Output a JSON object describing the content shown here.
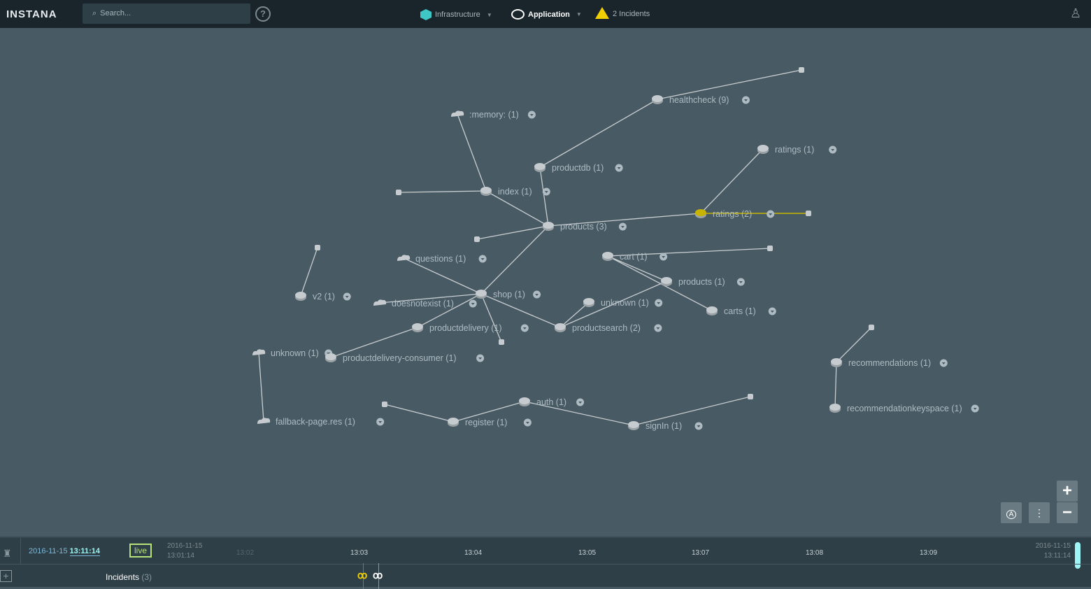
{
  "topbar": {
    "logo": "INSTANA",
    "search_placeholder": "Search...",
    "help": "?",
    "nav": [
      {
        "label": "Infrastructure",
        "icon": "hexagon-icon"
      },
      {
        "label": "Application",
        "icon": "disc-icon"
      },
      {
        "label": "2 Incidents",
        "icon": "warning-icon"
      }
    ]
  },
  "graph": {
    "nodes": [
      {
        "id": 1,
        "label": "healthcheck (9)",
        "kind": "db"
      },
      {
        "id": 2,
        "label": "",
        "kind": "small"
      },
      {
        "id": 3,
        "label": ":memory: (1)",
        "kind": "cloud"
      },
      {
        "id": 4,
        "label": "productdb (1)",
        "kind": "db"
      },
      {
        "id": 5,
        "label": "ratings (1)",
        "kind": "db"
      },
      {
        "id": 6,
        "label": "",
        "kind": "small"
      },
      {
        "id": 7,
        "label": "index (1)",
        "kind": "db"
      },
      {
        "id": 8,
        "label": "ratings (2)",
        "kind": "db",
        "highlight": true
      },
      {
        "id": 9,
        "label": "",
        "kind": "small"
      },
      {
        "id": 10,
        "label": "products (3)",
        "kind": "db"
      },
      {
        "id": 11,
        "label": "",
        "kind": "small"
      },
      {
        "id": 12,
        "label": "",
        "kind": "small"
      },
      {
        "id": 13,
        "label": "questions (1)",
        "kind": "cloud"
      },
      {
        "id": 14,
        "label": "cart (1)",
        "kind": "db"
      },
      {
        "id": 15,
        "label": "",
        "kind": "small"
      },
      {
        "id": 16,
        "label": "v2 (1)",
        "kind": "db"
      },
      {
        "id": 17,
        "label": "shop (1)",
        "kind": "db"
      },
      {
        "id": 18,
        "label": "products (1)",
        "kind": "db"
      },
      {
        "id": 19,
        "label": "doesnotexist (1)",
        "kind": "cloud"
      },
      {
        "id": 20,
        "label": "unknown (1)",
        "kind": "db"
      },
      {
        "id": 21,
        "label": "carts (1)",
        "kind": "db"
      },
      {
        "id": 22,
        "label": "productdelivery (1)",
        "kind": "db"
      },
      {
        "id": 23,
        "label": "productsearch (2)",
        "kind": "db"
      },
      {
        "id": 24,
        "label": "",
        "kind": "small"
      },
      {
        "id": 25,
        "label": "unknown (1)",
        "kind": "cloud"
      },
      {
        "id": 26,
        "label": "productdelivery-consumer (1)",
        "kind": "db"
      },
      {
        "id": 27,
        "label": "",
        "kind": "small"
      },
      {
        "id": 28,
        "label": "recommendations (1)",
        "kind": "db"
      },
      {
        "id": 29,
        "label": "auth (1)",
        "kind": "db"
      },
      {
        "id": 30,
        "label": "",
        "kind": "small"
      },
      {
        "id": 31,
        "label": "register (1)",
        "kind": "db"
      },
      {
        "id": 32,
        "label": "signIn (1)",
        "kind": "db"
      },
      {
        "id": 33,
        "label": "",
        "kind": "small"
      },
      {
        "id": 34,
        "label": "fallback-page.res (1)",
        "kind": "cloud"
      },
      {
        "id": 35,
        "label": "recommendationkeyspace (1)",
        "kind": "db"
      }
    ],
    "edges": [
      [
        2,
        1
      ],
      [
        1,
        4
      ],
      [
        4,
        10
      ],
      [
        3,
        7
      ],
      [
        6,
        7
      ],
      [
        7,
        10
      ],
      [
        11,
        10
      ],
      [
        10,
        8
      ],
      [
        8,
        5
      ],
      [
        9,
        8,
        "highlight"
      ],
      [
        17,
        10
      ],
      [
        17,
        13
      ],
      [
        17,
        19
      ],
      [
        17,
        22
      ],
      [
        17,
        24
      ],
      [
        17,
        23
      ],
      [
        22,
        26
      ],
      [
        23,
        20
      ],
      [
        23,
        18
      ],
      [
        18,
        14
      ],
      [
        14,
        21
      ],
      [
        15,
        14
      ],
      [
        12,
        16
      ],
      [
        25,
        34
      ],
      [
        27,
        28
      ],
      [
        28,
        35
      ],
      [
        30,
        31
      ],
      [
        31,
        29
      ],
      [
        29,
        32
      ],
      [
        32,
        33
      ]
    ]
  },
  "controls": {
    "zoom_in": "+",
    "zoom_out": "−",
    "auto_layout": "A"
  },
  "timeline": {
    "date": "2016-11-15",
    "time": "13:11:14",
    "live": "live",
    "start_date": "2016-11-15",
    "start_time": "13:01:14",
    "end_date": "2016-11-15",
    "end_time": "13:11:14",
    "ticks": [
      "13:02",
      "13:03",
      "13:04",
      "13:05",
      "13:07",
      "13:08",
      "13:09"
    ],
    "incidents_label": "Incidents",
    "incidents_count": "(3)",
    "add": "+"
  },
  "colors": {
    "highlight": "#c8b400",
    "node": "#c5cbce",
    "incident_yellow": "#f1d000",
    "accent": "#9ff5f5"
  }
}
